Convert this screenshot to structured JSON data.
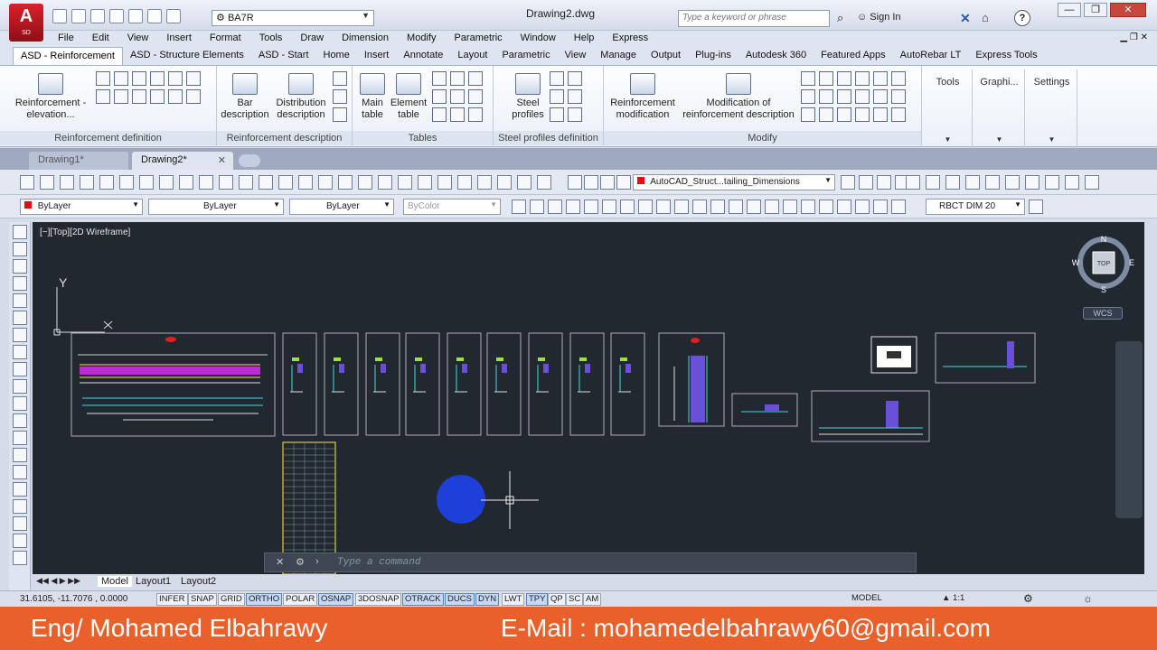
{
  "app": {
    "logo_letter": "A",
    "logo_sub": "SD",
    "doc_title": "Drawing2.dwg",
    "workspace": "BA7R",
    "search_placeholder": "Type a keyword or phrase",
    "signin": "Sign In",
    "help": "?"
  },
  "window_buttons": {
    "minimize": "—",
    "restore": "❐",
    "close": "✕"
  },
  "menu": [
    "File",
    "Edit",
    "View",
    "Insert",
    "Format",
    "Tools",
    "Draw",
    "Dimension",
    "Modify",
    "Parametric",
    "Window",
    "Help",
    "Express"
  ],
  "ribbon_tabs": [
    {
      "label": "ASD - Reinforcement",
      "active": true
    },
    {
      "label": "ASD - Structure Elements"
    },
    {
      "label": "ASD - Start"
    },
    {
      "label": "Home"
    },
    {
      "label": "Insert"
    },
    {
      "label": "Annotate"
    },
    {
      "label": "Layout"
    },
    {
      "label": "Parametric"
    },
    {
      "label": "View"
    },
    {
      "label": "Manage"
    },
    {
      "label": "Output"
    },
    {
      "label": "Plug-ins"
    },
    {
      "label": "Autodesk 360"
    },
    {
      "label": "Featured Apps"
    },
    {
      "label": "AutoRebar LT"
    },
    {
      "label": "Express Tools"
    }
  ],
  "ribbon": {
    "panels": {
      "reinf_def": {
        "title": "Reinforcement definition",
        "btn": "Reinforcement - elevation..."
      },
      "reinf_desc": {
        "title": "Reinforcement description",
        "bar": "Bar description",
        "dist": "Distribution description"
      },
      "tables": {
        "title": "Tables",
        "main": "Main table",
        "element": "Element table"
      },
      "steel": {
        "title": "Steel profiles definition",
        "btn": "Steel profiles"
      },
      "modify": {
        "title": "Modify",
        "reinf_mod": "Reinforcement modification",
        "mod_desc": "Modification of reinforcement description"
      },
      "tools": "Tools",
      "graphics": "Graphi...",
      "settings": "Settings"
    }
  },
  "doc_tabs": [
    {
      "label": "Drawing1*",
      "active": false
    },
    {
      "label": "Drawing2*",
      "active": true
    }
  ],
  "toolbar": {
    "layer_combo": "AutoCAD_Struct...tailing_Dimensions",
    "color": "ByLayer",
    "linetype": "ByLayer",
    "lineweight": "ByLayer",
    "plotstyle": "ByColor",
    "dimstyle": "RBCT DIM 20"
  },
  "viewport": {
    "label": "[−][Top][2D Wireframe]",
    "wcs": "WCS",
    "compass": {
      "n": "N",
      "s": "S",
      "e": "E",
      "w": "W",
      "top": "TOP"
    },
    "ucs_x": "X",
    "ucs_y": "Y"
  },
  "command_line": {
    "placeholder": "Type a command"
  },
  "layout_tabs": [
    "Model",
    "Layout1",
    "Layout2"
  ],
  "status": {
    "coords": "31.6105, -11.7076 , 0.0000",
    "toggles": [
      {
        "label": "INFER",
        "on": false
      },
      {
        "label": "SNAP",
        "on": false
      },
      {
        "label": "GRID",
        "on": false
      },
      {
        "label": "ORTHO",
        "on": true
      },
      {
        "label": "POLAR",
        "on": false
      },
      {
        "label": "OSNAP",
        "on": true
      },
      {
        "label": "3DOSNAP",
        "on": false
      },
      {
        "label": "OTRACK",
        "on": true
      },
      {
        "label": "DUCS",
        "on": true
      },
      {
        "label": "DYN",
        "on": true
      },
      {
        "label": "LWT",
        "on": false
      },
      {
        "label": "TPY",
        "on": true
      },
      {
        "label": "QP",
        "on": false
      },
      {
        "label": "SC",
        "on": false
      },
      {
        "label": "AM",
        "on": false
      }
    ],
    "model": "MODEL",
    "scale": "1:1"
  },
  "banner": {
    "name": "Eng/ Mohamed Elbahrawy",
    "email": "E-Mail : mohamedelbahrawy60@gmail.com"
  },
  "colors": {
    "banner": "#e9602b",
    "canvas": "#212830",
    "accent_circle": "#1e3fd8"
  }
}
